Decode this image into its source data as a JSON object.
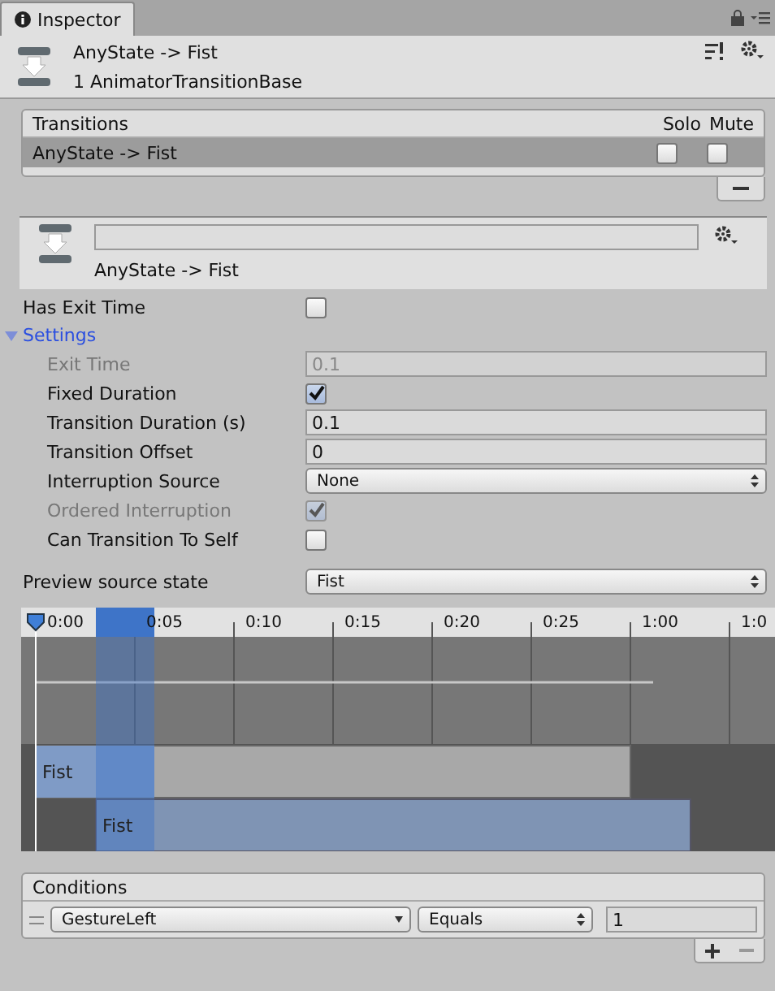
{
  "tab": {
    "label": "Inspector",
    "selected": true
  },
  "header": {
    "title": "AnyState -> Fist",
    "subtitle": "1 AnimatorTransitionBase"
  },
  "transitions": {
    "title": "Transitions",
    "columns": [
      "Solo",
      "Mute"
    ],
    "rows": [
      {
        "name": "AnyState -> Fist",
        "selected": true,
        "solo": false,
        "mute": false
      }
    ]
  },
  "transition": {
    "label": "AnyState -> Fist"
  },
  "has_exit_time": {
    "label": "Has Exit Time",
    "checked": false
  },
  "settings": {
    "label": "Settings",
    "expanded": true,
    "fields": [
      {
        "kind": "text",
        "label": "Exit Time",
        "value": "0.1",
        "disabled": true
      },
      {
        "kind": "checkbox",
        "label": "Fixed Duration",
        "checked": true,
        "disabled": false
      },
      {
        "kind": "text",
        "label": "Transition Duration (s)",
        "value": "0.1",
        "disabled": false
      },
      {
        "kind": "text",
        "label": "Transition Offset",
        "value": "0",
        "disabled": false
      },
      {
        "kind": "dropdown",
        "label": "Interruption Source",
        "value": "None",
        "disabled": false
      },
      {
        "kind": "checkbox",
        "label": "Ordered Interruption",
        "checked": true,
        "disabled": true
      },
      {
        "kind": "checkbox",
        "label": "Can Transition To Self",
        "checked": false,
        "disabled": false
      }
    ]
  },
  "preview": {
    "label": "Preview source state",
    "value": "Fist"
  },
  "timeline": {
    "ticks": [
      "0:00",
      "0:05",
      "0:10",
      "0:15",
      "0:20",
      "0:25",
      "1:00",
      "1:0"
    ],
    "tracks": [
      {
        "label": "Fist"
      },
      {
        "label": "Fist"
      }
    ]
  },
  "conditions": {
    "title": "Conditions",
    "rows": [
      {
        "parameter": "GestureLeft",
        "mode": "Equals",
        "value": "1"
      }
    ]
  }
}
